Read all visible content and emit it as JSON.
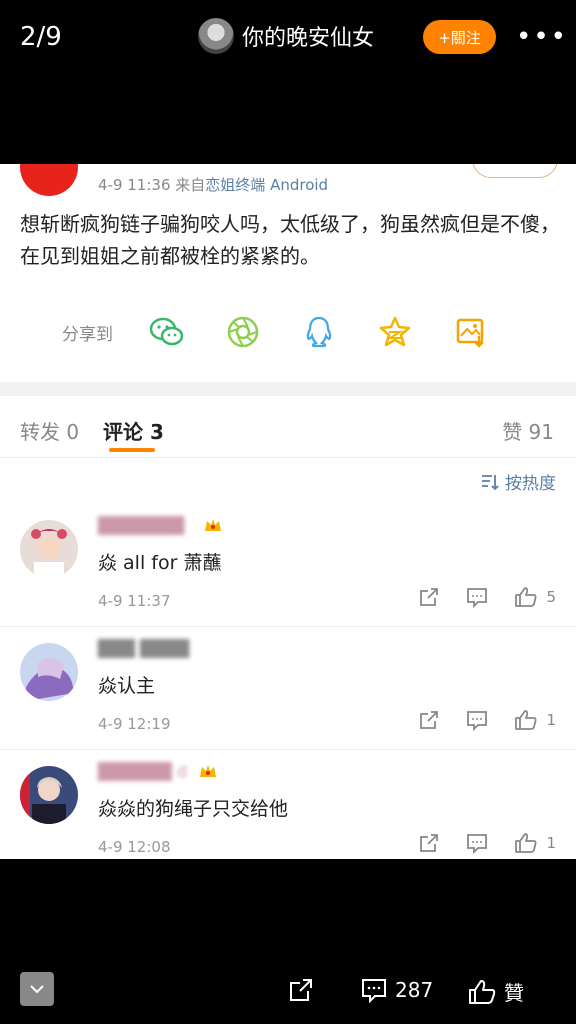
{
  "header": {
    "page_counter": "2/9",
    "title": "你的晚安仙女",
    "follow_label": "+關注",
    "more_label": "•••"
  },
  "post": {
    "time": "4-9 11:36",
    "from_prefix": "来自",
    "source": "恋姐终端 Android",
    "text": "想斩断疯狗链子骗狗咬人吗，太低级了，狗虽然疯但是不傻，在见到姐姐之前都被栓的紧紧的。",
    "share_label": "分享到"
  },
  "tabs": {
    "repost": "转发 0",
    "comments": "评论 3",
    "likes": "赞 91"
  },
  "sort_label": "按热度",
  "comments": [
    {
      "text": "焱 all for 萧蘸",
      "time": "4-9 11:37",
      "likes": "5"
    },
    {
      "text": "焱认主",
      "time": "4-9 12:19",
      "likes": "1"
    },
    {
      "text": "焱焱的狗绳子只交给他",
      "time": "4-9 12:08",
      "likes": "1"
    }
  ],
  "bottom": {
    "comment_count": "287",
    "like_label": "贊"
  },
  "colors": {
    "accent": "#ff8200",
    "link": "#5b7fa6",
    "avatar_red": "#e8231b"
  }
}
